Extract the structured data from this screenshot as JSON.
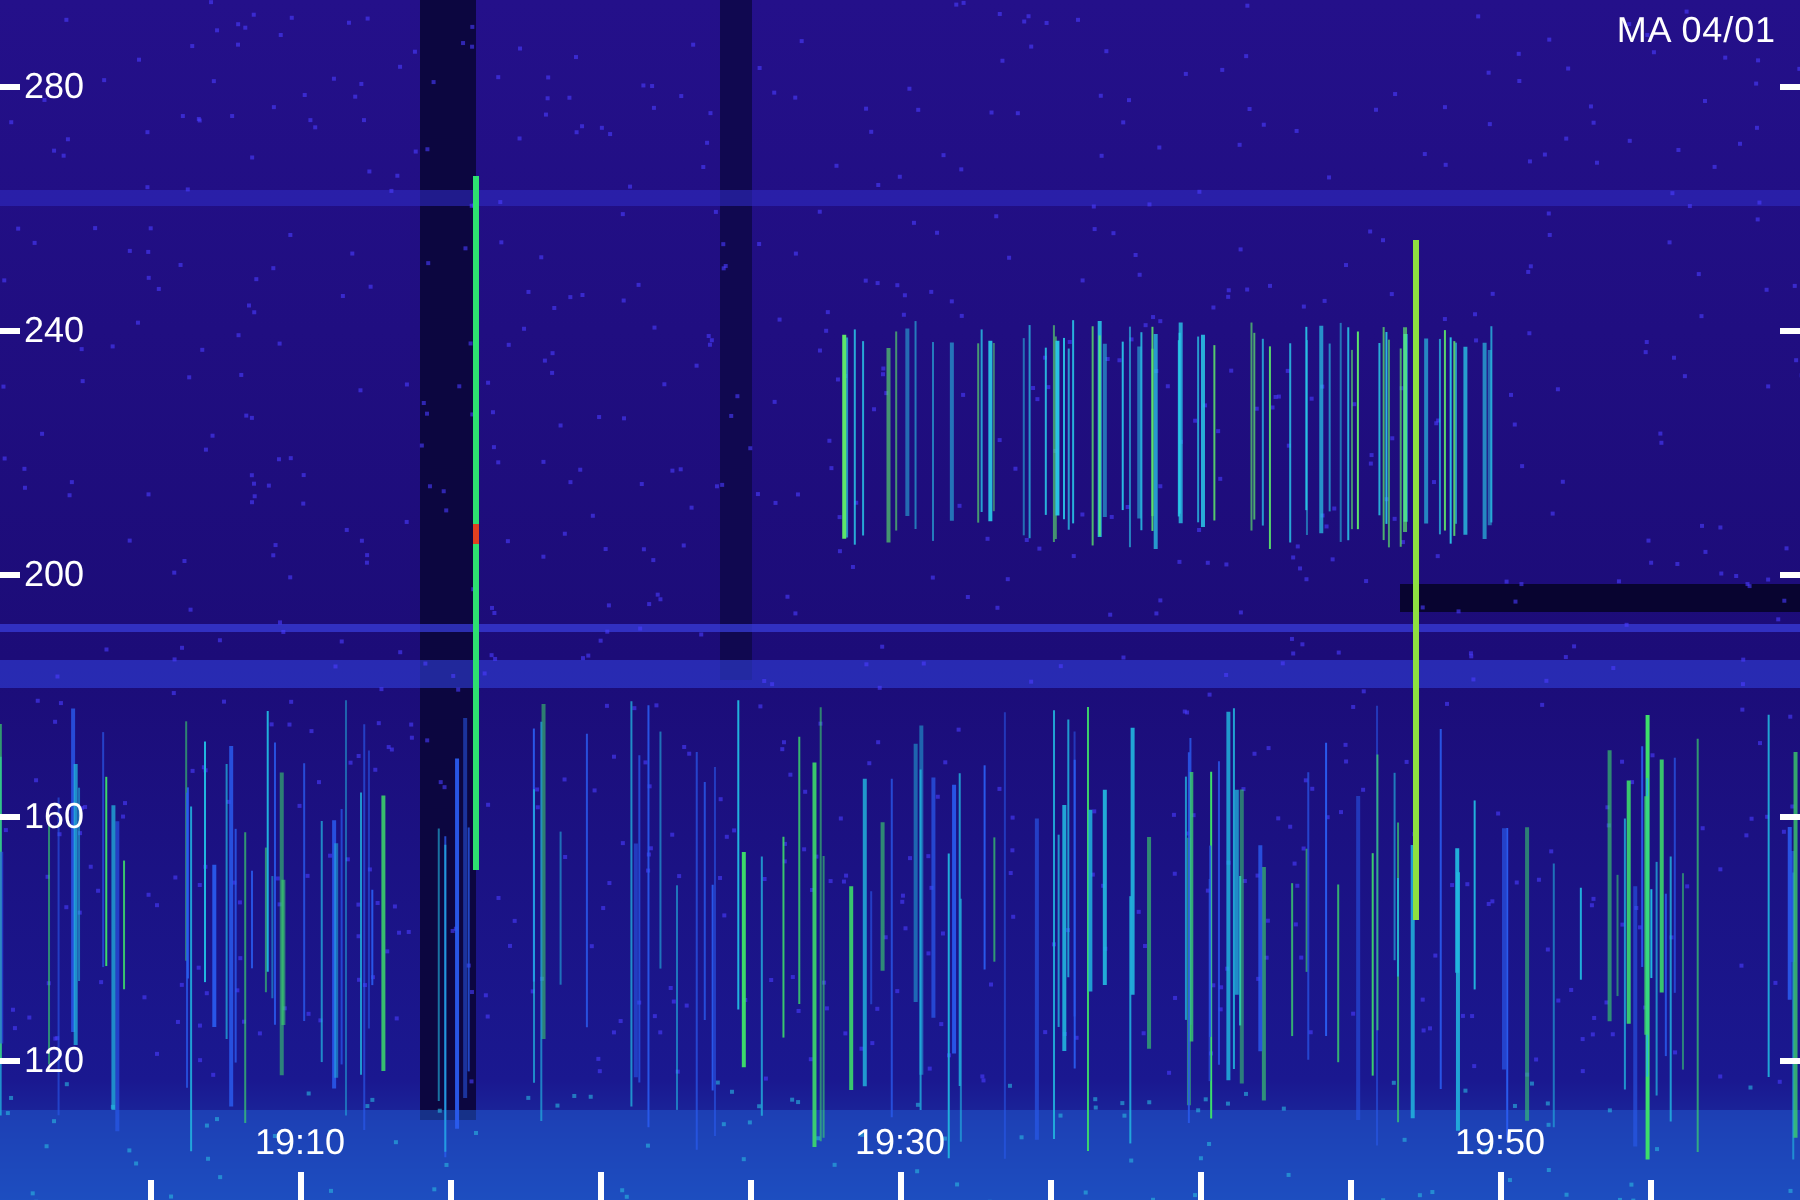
{
  "title": "MA 04/01",
  "y_axis": {
    "labels": [
      "280",
      "240",
      "200",
      "160",
      "120"
    ]
  },
  "x_axis": {
    "labels": [
      "19:10",
      "19:30",
      "19:50"
    ]
  }
}
